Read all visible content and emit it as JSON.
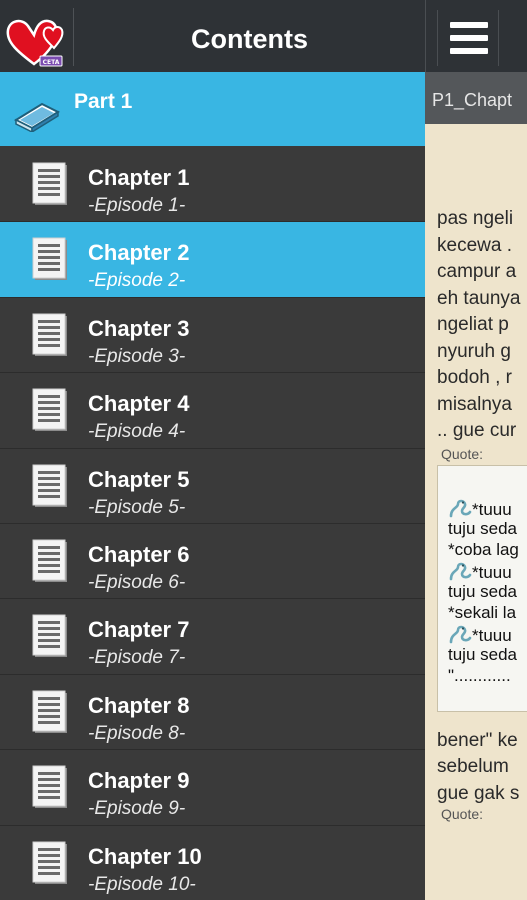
{
  "drawer": {
    "title": "Contents",
    "logo_icon": "hearts-book-logo-icon",
    "logo_label": "CETA",
    "part": {
      "label": "Part 1",
      "icon": "book-icon"
    },
    "chapters": [
      {
        "title": "Chapter 1",
        "subtitle": "-Episode 1-",
        "selected": false
      },
      {
        "title": "Chapter 2",
        "subtitle": "-Episode 2-",
        "selected": true
      },
      {
        "title": "Chapter 3",
        "subtitle": "-Episode 3-",
        "selected": false
      },
      {
        "title": "Chapter 4",
        "subtitle": "-Episode 4-",
        "selected": false
      },
      {
        "title": "Chapter 5",
        "subtitle": "-Episode 5-",
        "selected": false
      },
      {
        "title": "Chapter 6",
        "subtitle": "-Episode 6-",
        "selected": false
      },
      {
        "title": "Chapter 7",
        "subtitle": "-Episode 7-",
        "selected": false
      },
      {
        "title": "Chapter 8",
        "subtitle": "-Episode 8-",
        "selected": false
      },
      {
        "title": "Chapter 9",
        "subtitle": "-Episode 9-",
        "selected": false
      },
      {
        "title": "Chapter 10",
        "subtitle": "-Episode 10-",
        "selected": false
      }
    ]
  },
  "reader": {
    "menu_icon": "hamburger-menu-icon",
    "title": "P1_Chapt",
    "paragraph1": [
      "pas ngeli",
      "kecewa .",
      "campur a",
      "eh taunya",
      "ngeliat p",
      "nyuruh g",
      "bodoh , r",
      "misalnya",
      ".. gue cur"
    ],
    "quote1_label": "Quote:",
    "quote1_lines": [
      "*tuuu",
      "tuju seda",
      "*coba lag",
      "*tuuu",
      "tuju seda",
      "*sekali la",
      "*tuuu",
      "tuju seda",
      "\"............"
    ],
    "paragraph2": [
      "bener\" ke",
      "sebelum",
      "gue gak s"
    ],
    "quote2_label": "Quote:"
  },
  "colors": {
    "accent": "#39b6e3",
    "drawer_bg": "#3a3a3a",
    "header_bg": "#2e3236",
    "paper_bg": "#eee4cc"
  }
}
